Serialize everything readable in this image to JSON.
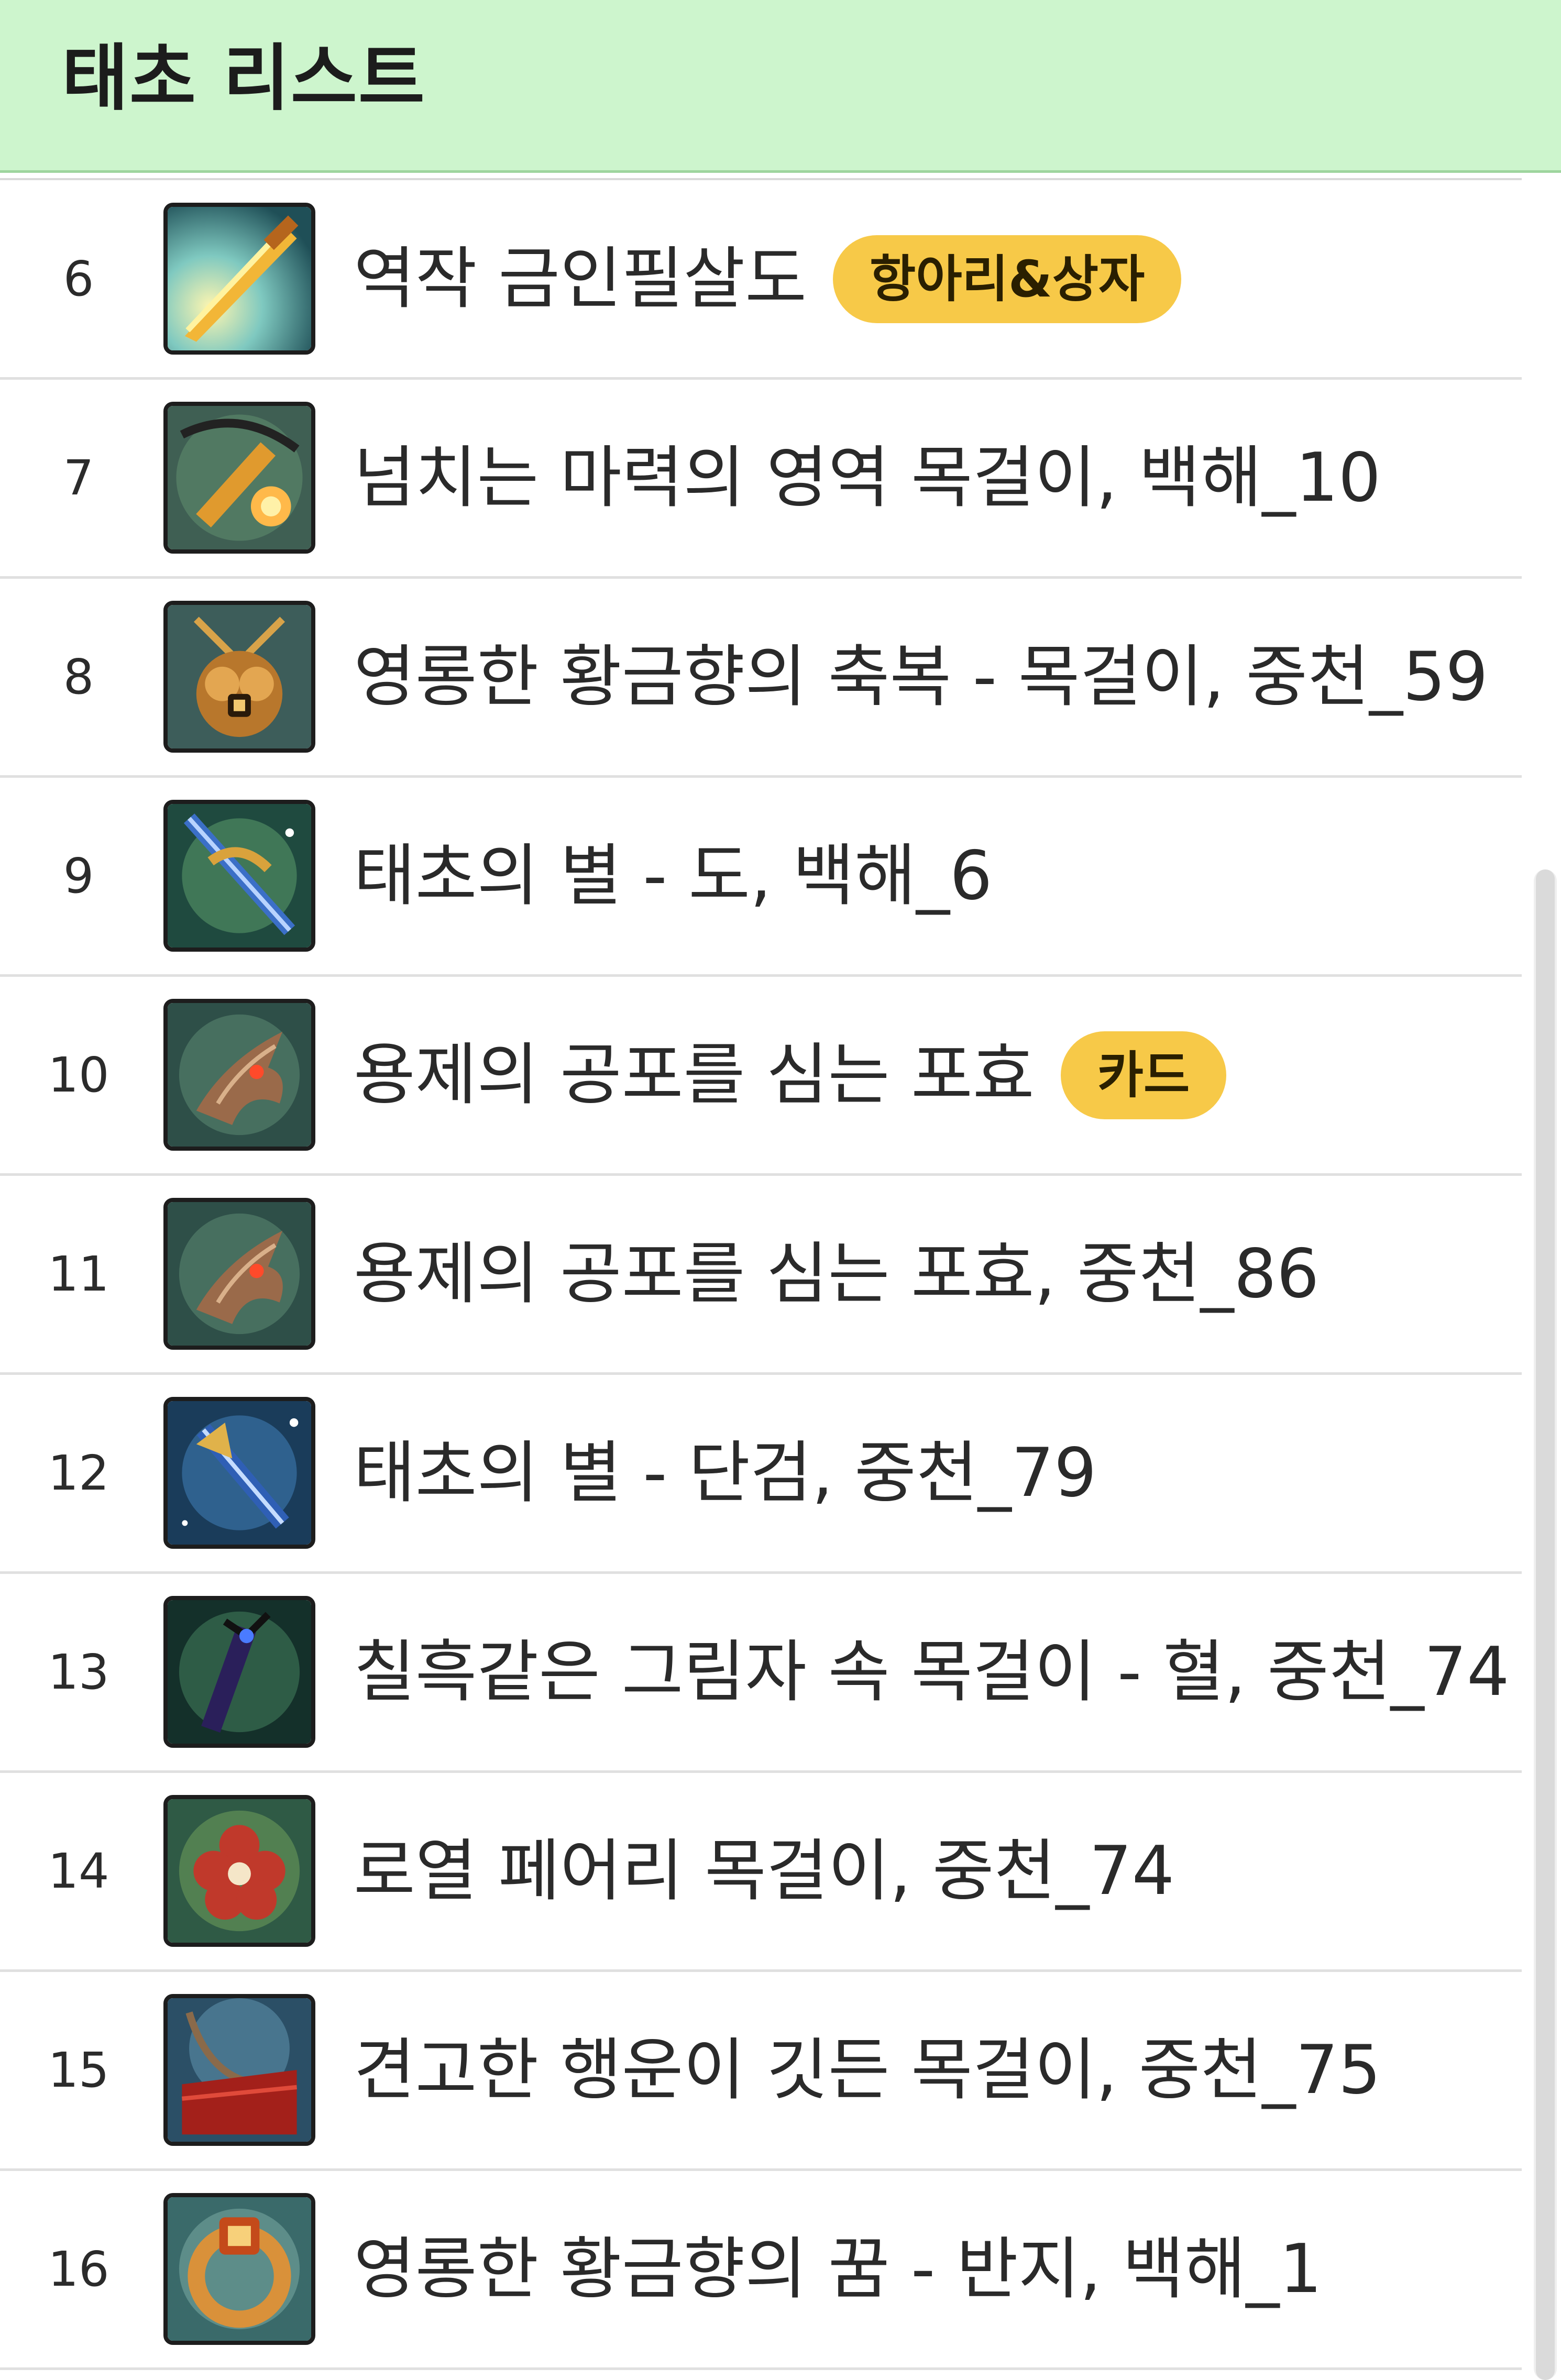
{
  "header": {
    "title": "태초 리스트"
  },
  "colors": {
    "header_bg": "#cdf5cd",
    "badge": "#f7c948"
  },
  "items": [
    {
      "rank": "6",
      "name": "역작 금인필살도",
      "badge": "항아리&상자",
      "icon": "golden-sword-icon"
    },
    {
      "rank": "7",
      "name": "넘치는 마력의 영역 목걸이, 백해_10",
      "badge": "",
      "icon": "mana-necklace-icon"
    },
    {
      "rank": "8",
      "name": "영롱한 황금향의 축복 - 목걸이, 중천_59",
      "badge": "",
      "icon": "golden-amulet-icon"
    },
    {
      "rank": "9",
      "name": "태초의 별 - 도, 백해_6",
      "badge": "",
      "icon": "star-blade-icon"
    },
    {
      "rank": "10",
      "name": "용제의 공포를 심는 포효",
      "badge": "카드",
      "icon": "dragon-emperor-icon"
    },
    {
      "rank": "11",
      "name": "용제의 공포를 심는 포효, 중천_86",
      "badge": "",
      "icon": "dragon-emperor-icon"
    },
    {
      "rank": "12",
      "name": "태초의 별 - 단검, 중천_79",
      "badge": "",
      "icon": "star-dagger-icon"
    },
    {
      "rank": "13",
      "name": "칠흑같은 그림자 속 목걸이 - 혈, 중천_74",
      "badge": "",
      "icon": "shadow-necklace-icon"
    },
    {
      "rank": "14",
      "name": "로열 페어리 목걸이, 중천_74",
      "badge": "",
      "icon": "fairy-flower-necklace-icon"
    },
    {
      "rank": "15",
      "name": "견고한 행운이 깃든 목걸이, 중천_75",
      "badge": "",
      "icon": "lucky-necklace-icon"
    },
    {
      "rank": "16",
      "name": "영롱한 황금향의 꿈 - 반지, 백해_1",
      "badge": "",
      "icon": "golden-ring-icon"
    }
  ]
}
